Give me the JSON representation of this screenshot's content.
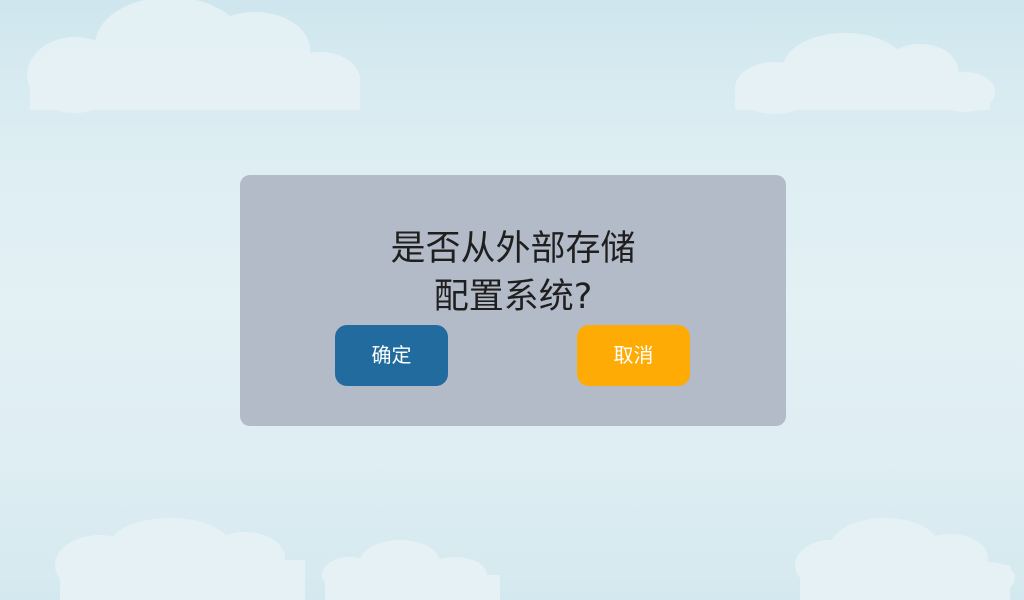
{
  "dialog": {
    "message_line1": "是否从外部存储",
    "message_line2": "配置系统?",
    "confirm_label": "确定",
    "cancel_label": "取消"
  },
  "colors": {
    "sky": "#dcedf2",
    "dialog_bg": "#b4bbc8",
    "confirm": "#216b9e",
    "cancel": "#feab05"
  }
}
